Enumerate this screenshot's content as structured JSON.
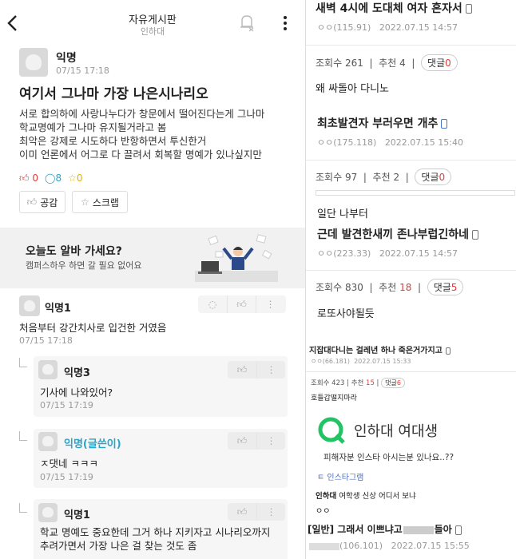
{
  "left": {
    "header": {
      "title": "자유게시판",
      "subtitle": "인하대"
    },
    "post": {
      "author": "익명",
      "time": "07/15 17:18",
      "title": "여기서 그나마 가장 나은시나리오",
      "body": [
        "서로 합의하에 사랑나누다가 창문에서 떨어진다는게 그나마",
        "학교명예가 그나마 유지될거라고 봄",
        "최악은 강제로 시도하다 반항하면서 투신한거",
        "이미 언론에서 어그로 다 끌려서 회복할 명예가 있나싶지만"
      ],
      "likes": "0",
      "comments": "8",
      "scraps": "0",
      "like_btn": "공감",
      "scrap_btn": "스크랩"
    },
    "ad": {
      "title": "오늘도 알바 가세요?",
      "subtitle": "캠퍼스하우 하면 갈 필요 없어요"
    },
    "comments": [
      {
        "author": "익명1",
        "text": "처음부터 강간치사로 입건한 거였음",
        "time": "07/15 17:18"
      },
      {
        "author": "익명3",
        "text": "기사에 나와있어?",
        "time": "07/15 17:19"
      },
      {
        "author": "익명(글쓴이)",
        "text": "ㅈ댓네 ㅋㅋㅋ",
        "time": "07/15 17:19"
      },
      {
        "author": "익명1",
        "text": [
          "학교 명예도 중요한데 그거 하나 지키자고 시나리오까지",
          "추려가면서 가장 나은 걸 찾는 것도 좀"
        ]
      }
    ]
  },
  "right": {
    "post1": {
      "title": "새벽 4시에 도대체 여자 혼자서",
      "meta_user": "ㅇㅇ(115.91)",
      "meta_date": "2022.07.15 14:57"
    },
    "stats1": {
      "views_label": "조회수",
      "views": "261",
      "rec_label": "추천",
      "rec": "4",
      "cmt_label": "댓글",
      "cmt": "0"
    },
    "text1": "왜 싸돌아 다니노",
    "post2": {
      "title": "최초발견자 부러우면 개추",
      "meta_user": "ㅇㅇ(175.118)",
      "meta_date": "2022.07.15 15:40"
    },
    "stats2": {
      "views_label": "조회수",
      "views": "97",
      "rec_label": "추천",
      "rec": "2",
      "cmt_label": "댓글",
      "cmt": "0"
    },
    "text2": "일단 나부터",
    "post3": {
      "title": "근데 발견한새끼 존나부럽긴하네",
      "meta_user": "ㅇㅇ(223.33)",
      "meta_date": "2022.07.15 14:57"
    },
    "stats3": {
      "views_label": "조회수",
      "views": "830",
      "rec_label": "추천",
      "rec": "18",
      "cmt_label": "댓글",
      "cmt": "5"
    },
    "text3": "로또사야될듯",
    "post4": {
      "title": "지잡대다니는 걸레년 하나 죽은거가지고",
      "meta_user": "ㅇㅇ(66.181)",
      "meta_date": "2022.07.15 15:33"
    },
    "stats4": {
      "views_label": "조회수",
      "views": "423",
      "rec_label": "추천",
      "rec": "15",
      "cmt_label": "댓글",
      "cmt": "6"
    },
    "text4": "호들갑떨지마라",
    "card": {
      "name": "인하대 여대생",
      "desc": "피해자분 인스타 아시는분 있나요..??",
      "link": "ㅌ 인스타그램"
    },
    "line5_bold": "인하대",
    "line5_rest": " 여학생 신상 어디서 보냐",
    "oo": "ㅇㅇ",
    "post5": {
      "prefix": "[일반]",
      "title": "그래서 이쁘냐고",
      "title_end": "들아",
      "meta_user": "(106.101)",
      "meta_date": "2022.07.15 15:55"
    }
  }
}
